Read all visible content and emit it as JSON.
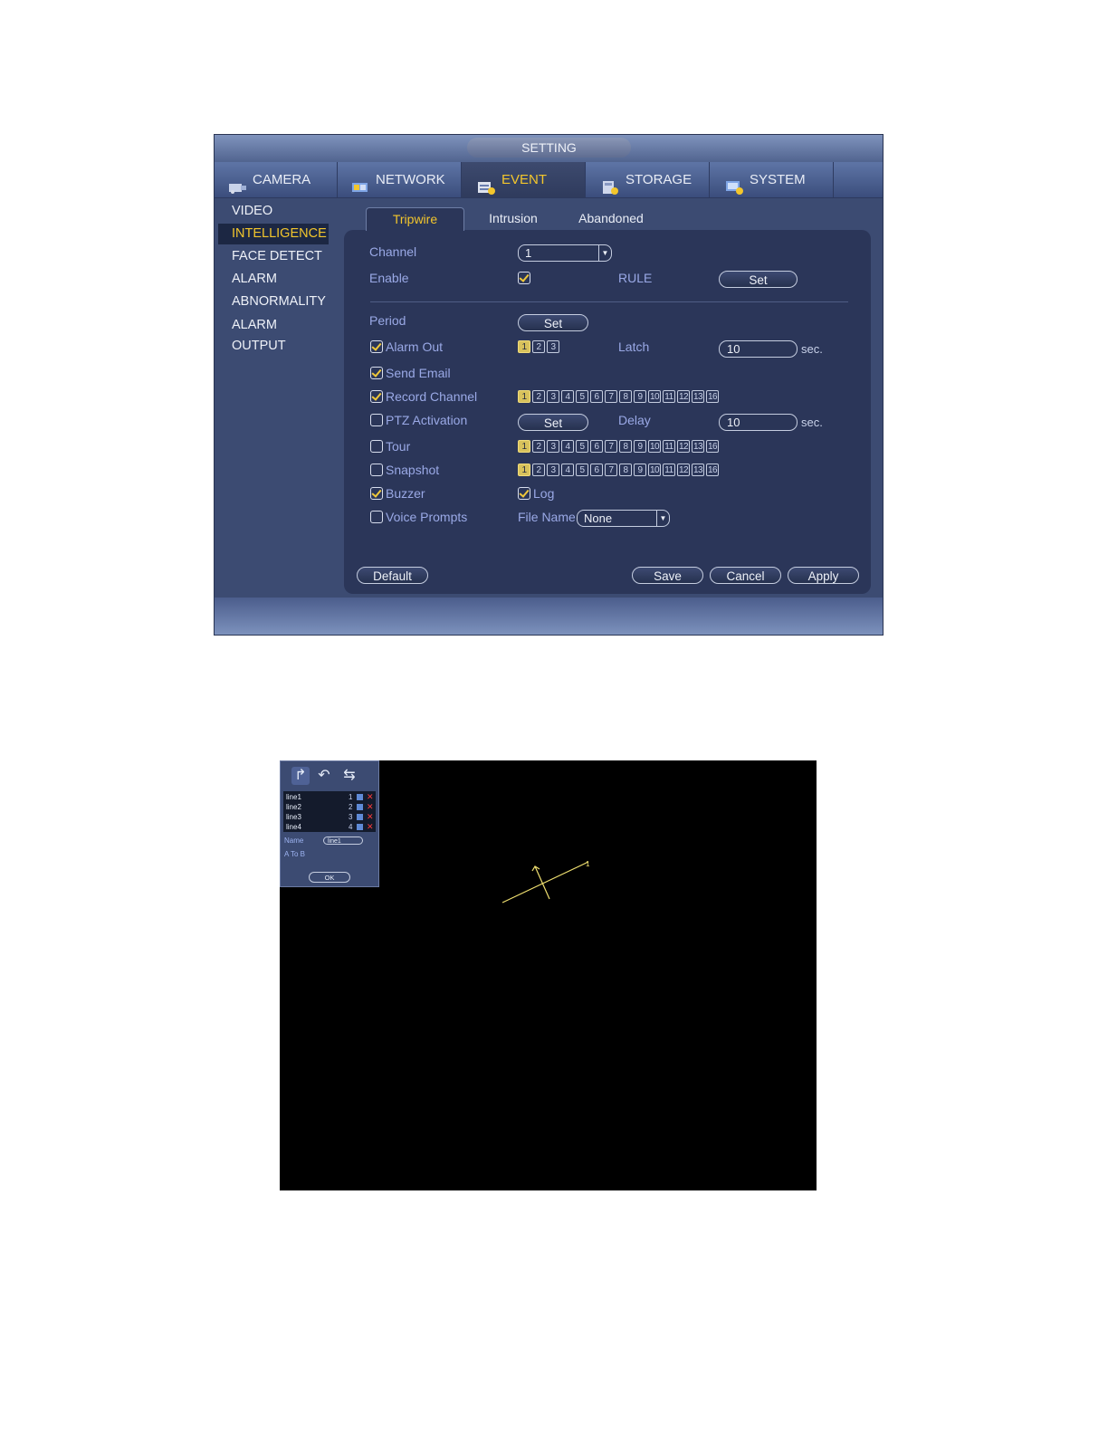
{
  "window": {
    "title": "SETTING"
  },
  "main_tabs": [
    {
      "label": "CAMERA",
      "icon": "camera-icon"
    },
    {
      "label": "NETWORK",
      "icon": "network-icon"
    },
    {
      "label": "EVENT",
      "icon": "event-icon",
      "active": true
    },
    {
      "label": "STORAGE",
      "icon": "storage-icon"
    },
    {
      "label": "SYSTEM",
      "icon": "system-icon"
    }
  ],
  "sidebar": {
    "items": [
      {
        "label": "VIDEO DETECT"
      },
      {
        "label": "INTELLIGENCE",
        "active": true
      },
      {
        "label": "FACE DETECT"
      },
      {
        "label": "ALARM"
      },
      {
        "label": "ABNORMALITY"
      },
      {
        "label": "ALARM OUTPUT"
      }
    ]
  },
  "sub_tabs": [
    {
      "label": "Tripwire",
      "active": true
    },
    {
      "label": "Intrusion"
    },
    {
      "label": "Abandoned"
    }
  ],
  "form": {
    "channel_label": "Channel",
    "channel_value": "1",
    "enable_label": "Enable",
    "enable_checked": true,
    "rule_label": "RULE",
    "rule_button": "Set",
    "period_label": "Period",
    "period_button": "Set",
    "alarm_out_label": "Alarm Out",
    "alarm_out_checked": true,
    "alarm_out_channels": [
      "1",
      "2",
      "3"
    ],
    "alarm_out_selected": [
      "1"
    ],
    "latch_label": "Latch",
    "latch_value": "10",
    "latch_unit": "sec.",
    "send_email_label": "Send Email",
    "send_email_checked": true,
    "record_channel_label": "Record Channel",
    "record_channel_checked": true,
    "ptz_label": "PTZ Activation",
    "ptz_checked": false,
    "ptz_button": "Set",
    "delay_label": "Delay",
    "delay_value": "10",
    "delay_unit": "sec.",
    "tour_label": "Tour",
    "tour_checked": false,
    "snapshot_label": "Snapshot",
    "snapshot_checked": false,
    "channels_16": [
      "1",
      "2",
      "3",
      "4",
      "5",
      "6",
      "7",
      "8",
      "9",
      "10",
      "11",
      "12",
      "13",
      "16"
    ],
    "channels_selected": [
      "1"
    ],
    "buzzer_label": "Buzzer",
    "buzzer_checked": true,
    "log_label": "Log",
    "log_checked": true,
    "voice_prompts_label": "Voice Prompts",
    "voice_prompts_checked": false,
    "file_name_label": "File Name",
    "file_name_value": "None"
  },
  "buttons": {
    "default": "Default",
    "save": "Save",
    "cancel": "Cancel",
    "apply": "Apply"
  },
  "colors": {
    "accent": "#f3c62c",
    "label": "#9aa9e6",
    "panel": "#2b3659",
    "window": "#3c4b72"
  },
  "draw_screen": {
    "tools": [
      "redo-arrow-icon",
      "undo-arrow-icon",
      "bidirectional-arrow-icon"
    ],
    "lines": [
      {
        "name": "line1",
        "number": "1"
      },
      {
        "name": "line2",
        "number": "2"
      },
      {
        "name": "line3",
        "number": "3"
      },
      {
        "name": "line4",
        "number": "4"
      }
    ],
    "name_label": "Name",
    "name_value": "line1",
    "direction_label": "A To B",
    "ok_button": "OK",
    "tripwire_marker": "1",
    "tripwire_color": "#f0e070"
  }
}
